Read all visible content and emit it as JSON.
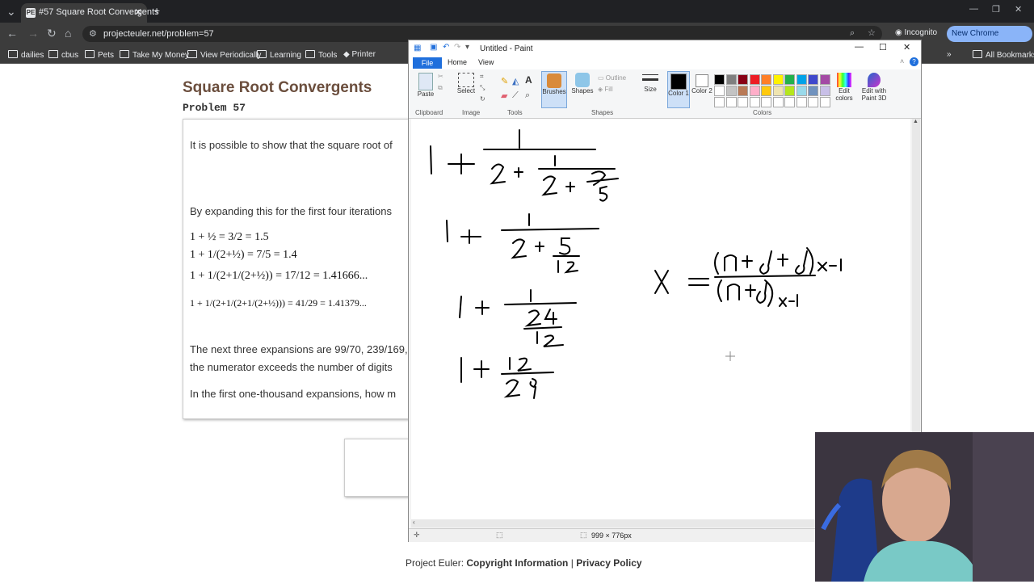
{
  "browser": {
    "tab_title": "#57 Square Root Convergents",
    "tab_favicon": "PE",
    "url": "projecteuler.net/problem=57",
    "incognito_label": "Incognito",
    "new_chrome_label": "New Chrome available",
    "bookmarks": [
      "dailies",
      "cbus",
      "Pets",
      "Take My Money",
      "View Periodically",
      "Learning",
      "Tools",
      "Printer"
    ],
    "all_bookmarks_label": "All Bookmarks"
  },
  "page": {
    "title": "Square Root Convergents",
    "subtitle": "Problem 57",
    "p1": "It is possible to show that the square root of",
    "p2": "By expanding this for the first four iterations",
    "math": [
      "1 + ½ = 3/2 = 1.5",
      "1 + 1/(2+½) = 7/5 = 1.4",
      "1 + 1/(2+1/(2+½)) = 17/12 = 1.41666...",
      "1 + 1/(2+1/(2+1/(2+½))) = 41/29 = 1.41379..."
    ],
    "p3": "The next three expansions are 99/70, 239/169, and",
    "p4": "the numerator exceeds the number of digits",
    "p5": "In the first one-thousand expansions, how m",
    "footer_prefix": "Project Euler:",
    "footer_copyright": "Copyright Information",
    "footer_sep": "|",
    "footer_privacy": "Privacy Policy"
  },
  "paint": {
    "window_title": "Untitled - Paint",
    "tabs": [
      "File",
      "Home",
      "View"
    ],
    "groups": {
      "clipboard": "Clipboard",
      "image": "Image",
      "tools": "Tools",
      "shapes": "Shapes",
      "colors": "Colors"
    },
    "buttons": {
      "paste": "Paste",
      "select": "Select",
      "brushes": "Brushes",
      "shapes": "Shapes",
      "outline": "Outline",
      "fill": "Fill",
      "size": "Size",
      "color1": "Color 1",
      "color2": "Color 2",
      "edit_colors": "Edit colors",
      "edit_paint3d": "Edit with Paint 3D"
    },
    "palette_row1": [
      "#000000",
      "#7f7f7f",
      "#880015",
      "#ed1c24",
      "#ff7f27",
      "#fff200",
      "#22b14c",
      "#00a2e8",
      "#3f48cc",
      "#a349a4"
    ],
    "palette_row2": [
      "#ffffff",
      "#c3c3c3",
      "#b97a57",
      "#ffaec9",
      "#ffc90e",
      "#efe4b0",
      "#b5e61d",
      "#99d9ea",
      "#7092be",
      "#c8bfe7"
    ],
    "status_size": "999 × 776px"
  }
}
